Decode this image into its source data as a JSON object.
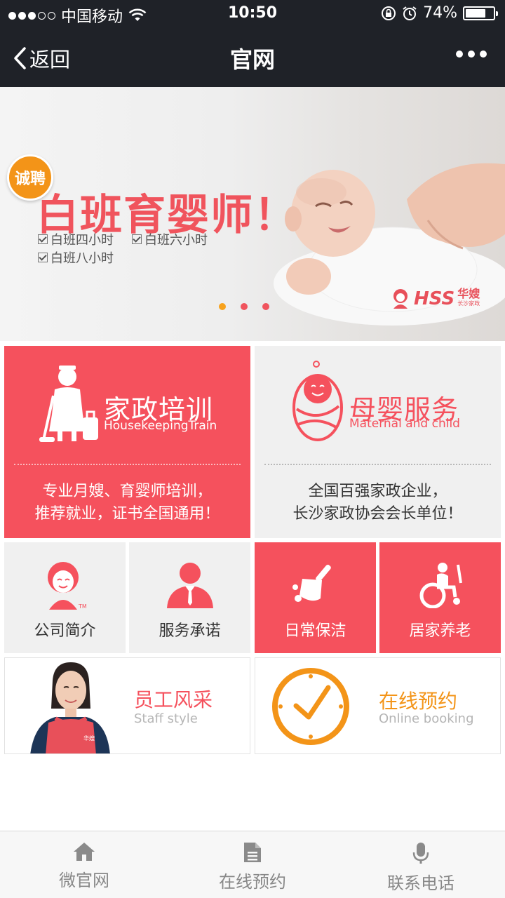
{
  "status_bar": {
    "carrier": "中国移动",
    "time": "10:50",
    "battery": "74%",
    "battery_level": 0.74,
    "signal_bars_filled": 3,
    "signal_bars_total": 5
  },
  "nav": {
    "back_label": "返回",
    "title": "官网"
  },
  "banner": {
    "badge": "诚聘",
    "headline": "白班育婴师！",
    "features": [
      "白班四小时",
      "白班六小时",
      "白班八小时"
    ],
    "brand": "HSS",
    "brand_cn": "华嫂",
    "brand_small": "长沙家政",
    "slides_total": 3,
    "active_slide": 0
  },
  "tiles": {
    "housekeeping": {
      "title": "家政培训",
      "subtitle": "HousekeepingTrain",
      "desc_line1": "专业月嫂、育婴师培训，",
      "desc_line2": "推荐就业，证书全国通用！"
    },
    "maternal": {
      "title": "母婴服务",
      "subtitle": "Maternal and child",
      "desc_line1": "全国百强家政企业，",
      "desc_line2": "长沙家政协会会长单位！"
    },
    "company": {
      "label": "公司简介",
      "tm": "TM"
    },
    "promise": {
      "label": "服务承诺"
    },
    "cleaning": {
      "label": "日常保洁"
    },
    "elderly": {
      "label": "居家养老"
    },
    "staff": {
      "title": "员工风采",
      "subtitle": "Staff style",
      "apron_text": "华嫂"
    },
    "booking": {
      "title": "在线预约",
      "subtitle": "Online booking"
    }
  },
  "tabbar": {
    "items": [
      {
        "label": "微官网",
        "icon": "home-icon"
      },
      {
        "label": "在线预约",
        "icon": "document-icon"
      },
      {
        "label": "联系电话",
        "icon": "microphone-icon"
      }
    ]
  },
  "colors": {
    "accent_red": "#f5515d",
    "accent_orange": "#f39418",
    "tile_grey": "#f0f0f0",
    "nav_bg": "#1f2228"
  }
}
